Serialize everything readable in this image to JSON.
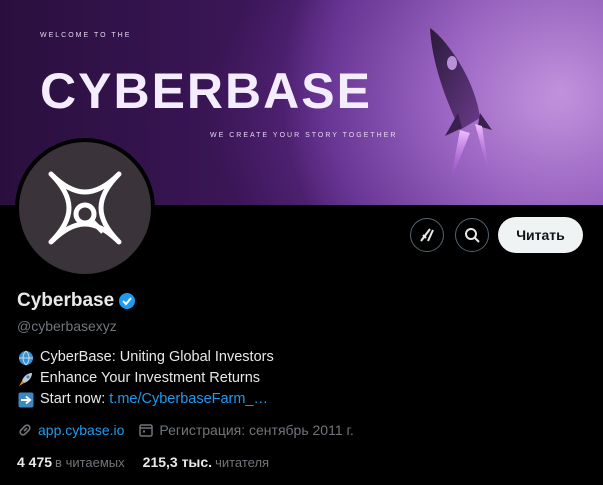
{
  "banner": {
    "welcome": "WELCOME TO THE",
    "title": "CYBERBASE",
    "tagline": "WE CREATE YOUR STORY TOGETHER"
  },
  "profile": {
    "name": "Cyberbase",
    "handle": "@cyberbasexyz",
    "follow_label": "Читать",
    "bio": [
      {
        "icon": "globe-icon",
        "text": "CyberBase: Uniting Global Investors"
      },
      {
        "icon": "rocket-icon",
        "text": "Enhance Your Investment Returns"
      },
      {
        "icon": "arrow-right-icon",
        "text": "Start now:",
        "link": "t.me/CyberbaseFarm_…"
      }
    ],
    "website": "app.cybase.io",
    "joined": "Регистрация: сентябрь 2011 г.",
    "following_count": "4 475",
    "following_label": "в читаемых",
    "followers_count": "215,3 тыс.",
    "followers_label": "читателя"
  },
  "colors": {
    "accent": "#1d9bf0",
    "background": "#000000",
    "text": "#e7e9ea",
    "muted": "#71767b",
    "banner_purple": "#5a2a86"
  }
}
